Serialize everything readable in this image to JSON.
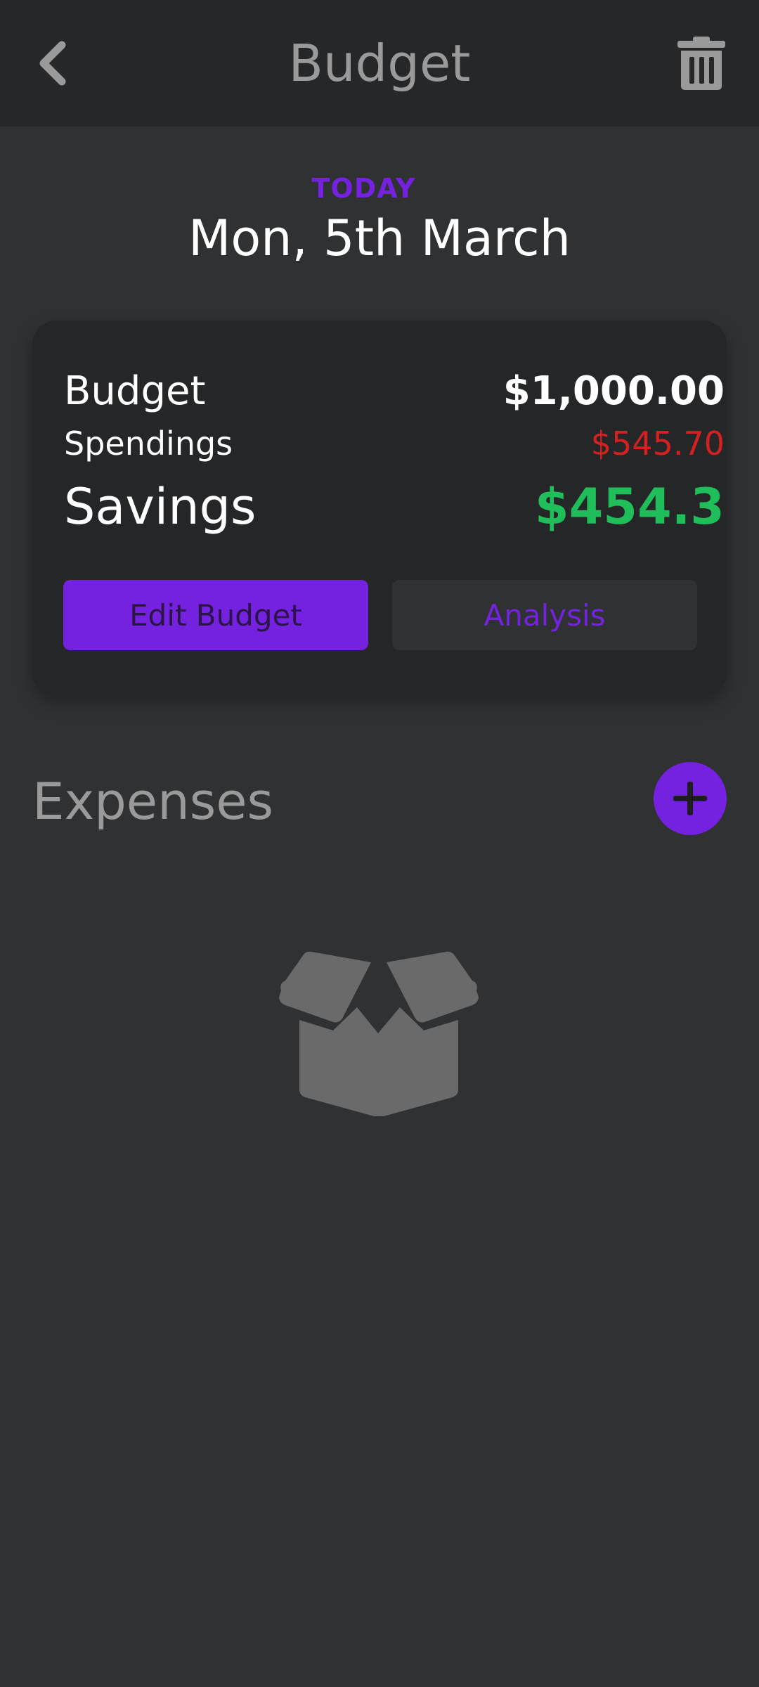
{
  "header": {
    "title": "Budget",
    "back_icon": "chevron-left-icon",
    "delete_icon": "trash-icon"
  },
  "date": {
    "today_label": "TODAY",
    "date_text": "Mon, 5th March"
  },
  "summary": {
    "budget_label": "Budget",
    "budget_value": "$1,000.00",
    "spendings_label": "Spendings",
    "spendings_value": "$545.70",
    "savings_label": "Savings",
    "savings_value": "$454.3"
  },
  "actions": {
    "edit_budget_label": "Edit Budget",
    "analysis_label": "Analysis"
  },
  "expenses": {
    "title": "Expenses",
    "add_icon": "plus-icon",
    "empty_icon": "open-box-icon"
  },
  "colors": {
    "accent": "#7521e0",
    "spendings": "#d42020",
    "savings": "#1fbe5a",
    "background": "#2f3133",
    "card": "#252628",
    "app_bar": "#262729"
  }
}
